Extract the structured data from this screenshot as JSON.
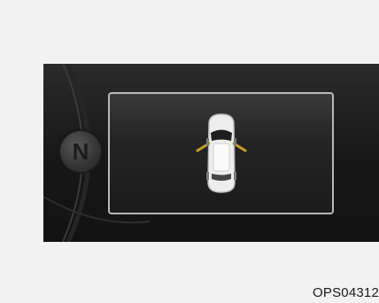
{
  "cluster": {
    "gear_indicator": "N",
    "display": {
      "warning_icon": "door-open-warning-icon",
      "doors_open": [
        "front-left",
        "front-right"
      ],
      "door_indicator_color": "#c8a028"
    }
  },
  "caption": {
    "text": "OPS04312"
  },
  "colors": {
    "page_background": "#f2f2f2",
    "cluster_background": "#1a1a1a",
    "display_border": "#b8b8b8"
  }
}
